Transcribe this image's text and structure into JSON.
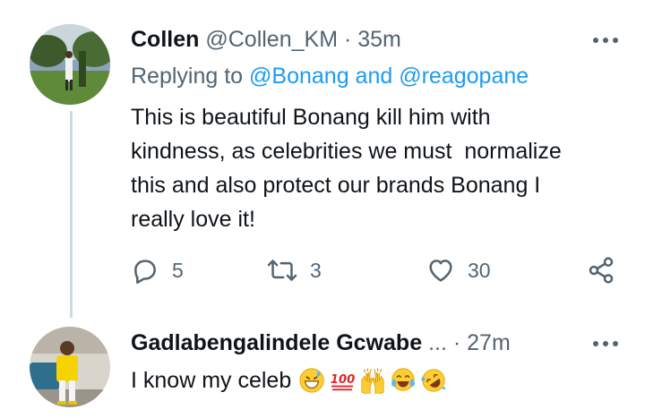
{
  "tweet": {
    "name": "Collen",
    "handle": "@Collen_KM",
    "dot": "·",
    "time": "35m",
    "replying_prefix": "Replying to ",
    "replying_user1": "@Bonang",
    "replying_and": " and ",
    "replying_user2": "@reagopane",
    "text_lines": [
      "This is beautiful Bonang kill him with",
      "kindness, as celebrities we must  normalize",
      "this and also protect our brands Bonang I",
      "really love it!"
    ],
    "replies": "5",
    "retweets": "3",
    "likes": "30"
  },
  "reply": {
    "name": "Gadlabengalindele Gcwabe",
    "ellipsis": "...",
    "dot": "·",
    "time": "27m",
    "text": "I know my celeb",
    "emojis": [
      "grinning-sweat-emoji",
      "hundred-points-emoji",
      "raising-hands-emoji",
      "tears-of-joy-emoji",
      "rolling-laughing-emoji"
    ]
  },
  "colors": {
    "link": "#1d9bf0",
    "muted": "#536471",
    "text": "#0f1419",
    "thread_line": "#cfd9de"
  }
}
